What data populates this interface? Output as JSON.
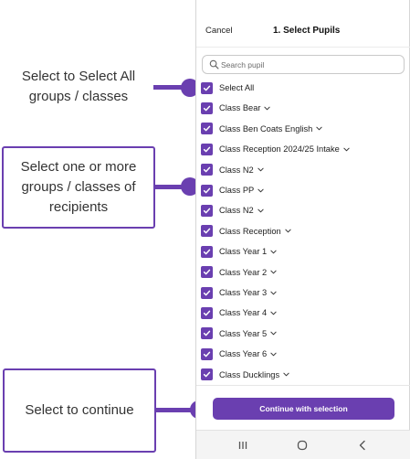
{
  "header": {
    "cancel_label": "Cancel",
    "title": "1. Select Pupils"
  },
  "search": {
    "placeholder": "Search pupil"
  },
  "list": {
    "select_all_label": "Select All",
    "items": [
      {
        "label": "Class Bear",
        "checked": true
      },
      {
        "label": "Class Ben Coats English",
        "checked": true
      },
      {
        "label": "Class Reception 2024/25 Intake",
        "checked": true
      },
      {
        "label": "Class N2",
        "checked": true
      },
      {
        "label": "Class PP",
        "checked": true
      },
      {
        "label": "Class N2",
        "checked": true
      },
      {
        "label": "Class Reception",
        "checked": true
      },
      {
        "label": "Class Year 1",
        "checked": true
      },
      {
        "label": "Class Year 2",
        "checked": true
      },
      {
        "label": "Class Year 3",
        "checked": true
      },
      {
        "label": "Class Year 4",
        "checked": true
      },
      {
        "label": "Class Year 5",
        "checked": true
      },
      {
        "label": "Class Year 6",
        "checked": true
      },
      {
        "label": "Class Ducklings",
        "checked": true
      }
    ]
  },
  "footer": {
    "continue_label": "Continue with selection"
  },
  "callouts": {
    "select_all": "Select to Select All groups / classes",
    "select_groups": "Select one or more groups / classes of recipients",
    "continue": "Select to continue"
  },
  "colors": {
    "accent": "#6a3fb0"
  },
  "icons": {
    "search": "search-icon",
    "checkbox": "checkbox-checked-icon",
    "chevron": "chevron-down-icon",
    "nav_recents": "recents-icon",
    "nav_home": "home-icon",
    "nav_back": "back-icon"
  }
}
